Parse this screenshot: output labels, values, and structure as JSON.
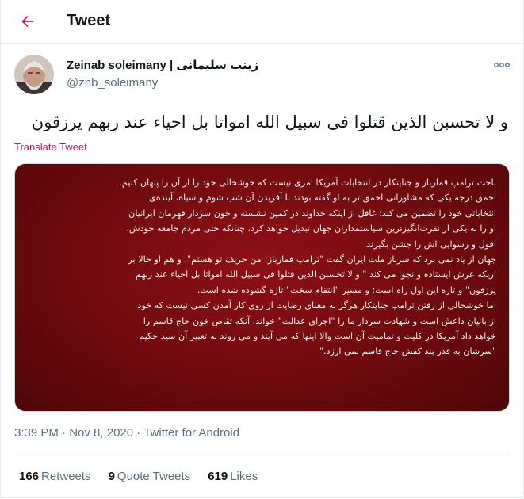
{
  "header": {
    "title": "Tweet",
    "back_icon": "back-arrow-icon",
    "accent_color": "#c2185b"
  },
  "author": {
    "display_name": "Zeinab soleimany | زینب سلیمانی",
    "handle": "@znb_soleimany",
    "avatar_icon": "avatar-photo"
  },
  "tweet": {
    "text": "و لا تحسبن الذین قتلوا فی سبیل الله امواتا بل احیاء عند ربهم یرزقون",
    "translate_label": "Translate Tweet",
    "more_icon": "more-options-icon"
  },
  "media": {
    "background_color": "#7a0c10",
    "lines": [
      "باخت ترامپ قمارباز و جنایتکار در انتخابات آمریکا امری نیست که خوشحالی خود را از آن را پنهان کنیم.",
      "احمق درجه یکی که مشاورانی احمق تر به او گفته بودند با آفریدن آن شب شوم و سیاه، آینده‌ی",
      "انتخاباتی خود را تضمین می کند؛ غافل از اینکه خداوند در کمین نشسته و خون سردار قهرمان ایرانیان",
      "او را به یکی از نفرت‌انگیزترین سیاستمداران جهان تبدیل خواهد کرد، چنانکه حتی مردم جامعه خودش،",
      "افول و رسوایی اش را جشن بگیرند.",
      "جهان از یاد نمی برد که سرباز ملت ایران گفت \"ترامپ قمارباز! من حریف تو هستم\"، و هم او حالا بر",
      "اریکه عرش ایستاده و نجوا می کند \" و لا تحسبن الذین قتلوا فی سبیل الله امواتا بل احیاء عند ربهم",
      "یرزقون\" و تازه این اول راه است؛ و مسیر \"انتقام سخت\" تازه گشوده شده است.",
      "اما خوشحالی از رفتن ترامپ جنایتکار هرگز به معنای رضایت از روی کار آمدن کسی نیست که خود",
      "از بانیان داعش است و شهادت سردار ما را \"اجرای عدالت\" خواند. آنکه تقاص خون حاج قاسم را",
      "خواهد داد آمریکا در کلیت و تمامیت آن است والا اینها که می آیند و می روند به تعبیر آن سید حکیم",
      "\"سرشان به قدر بند کفش حاج قاسم نمی ارزد.\""
    ]
  },
  "meta": {
    "time": "3:39 PM",
    "separator": "·",
    "date": "Nov 8, 2020",
    "source": "Twitter for Android"
  },
  "stats": {
    "retweets": {
      "count": "166",
      "label": "Retweets"
    },
    "quote_tweets": {
      "count": "9",
      "label": "Quote Tweets"
    },
    "likes": {
      "count": "619",
      "label": "Likes"
    }
  }
}
